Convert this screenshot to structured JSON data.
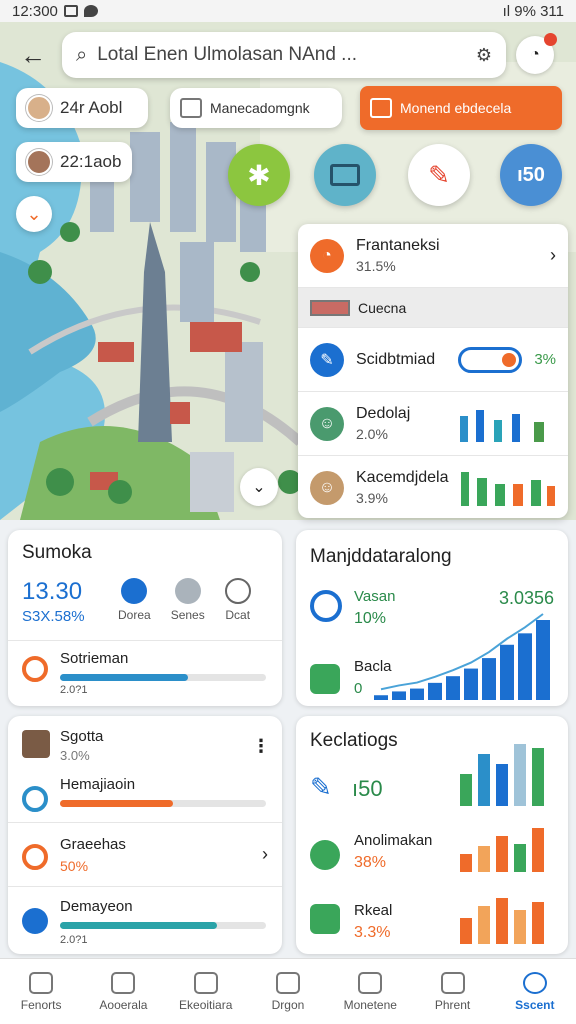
{
  "status_bar": {
    "time": "12:300",
    "right": "ıl 9% 311"
  },
  "search": {
    "text": "Lotal Enen Ulmolasan NAnd ..."
  },
  "chips": {
    "user1": "24r Aobl",
    "user2": "22:1aob",
    "filter": "Manecadomgnk",
    "action": "Monend ebdecela"
  },
  "map_buttons": [
    {
      "name": "gear",
      "color": "#8cc63f",
      "label": ""
    },
    {
      "name": "screen",
      "color": "#5fb3c9",
      "label": ""
    },
    {
      "name": "brush",
      "color": "#ffffff",
      "label": ""
    },
    {
      "name": "stats",
      "color": "#4a8fd4",
      "label": "ı50"
    }
  ],
  "overlay": {
    "rows": [
      {
        "title": "Frantaneksi",
        "sub": "31.5%",
        "color": "#ef6b2a"
      },
      {
        "title": "Cuecna",
        "sub": "",
        "color": ""
      },
      {
        "title": "Scidbtmiad",
        "sub": "",
        "value": "3%",
        "color": "#1b6fd0"
      },
      {
        "title": "Dedolaj",
        "sub": "2.0%",
        "color": "#4a9a6e"
      },
      {
        "title": "Kacemdjdela",
        "sub": "3.9%",
        "color": "#c49a6c"
      }
    ]
  },
  "card_summary": {
    "title": "Sumoka",
    "big": "13.30",
    "pct": "S3X.58%",
    "icons": [
      {
        "label": "Dorea"
      },
      {
        "label": "Senes"
      },
      {
        "label": "Dcat"
      }
    ],
    "row_label": "Sotrieman",
    "row_value": "2.0?1",
    "progress": 0.62,
    "progress_color": "#2b8fc9"
  },
  "card_mani": {
    "title": "Manjddataralong",
    "row1_label": "Vasan",
    "row1_pct": "10%",
    "row1_value": "3.0356",
    "row2_label": "Bacla",
    "row2_value": "0",
    "bars": [
      5,
      9,
      12,
      18,
      25,
      33,
      44,
      58,
      70,
      84
    ]
  },
  "card_list": {
    "person_name": "Sgotta",
    "person_pct": "3.0%",
    "row1_label": "Hemajiaoin",
    "row1_progress": 0.55,
    "row2_label": "Graeehas",
    "row2_value": "50%",
    "row3_label": "Demayeon",
    "row3_value": "2.0?1",
    "row3_progress": 0.76
  },
  "card_kecl": {
    "title": "Keclatiogs",
    "row1_value": "ı50",
    "row2_label": "Anolimakan",
    "row2_value": "38%",
    "row3_label": "Rkeal",
    "row3_value": "3.3%"
  },
  "bottom_nav": [
    {
      "label": "Fenorts",
      "active": false
    },
    {
      "label": "Aooerala",
      "active": false
    },
    {
      "label": "Ekeoitiara",
      "active": false
    },
    {
      "label": "Drgon",
      "active": false
    },
    {
      "label": "Monetene",
      "active": false
    },
    {
      "label": "Phrent",
      "active": false
    },
    {
      "label": "Sscent",
      "active": true
    }
  ]
}
